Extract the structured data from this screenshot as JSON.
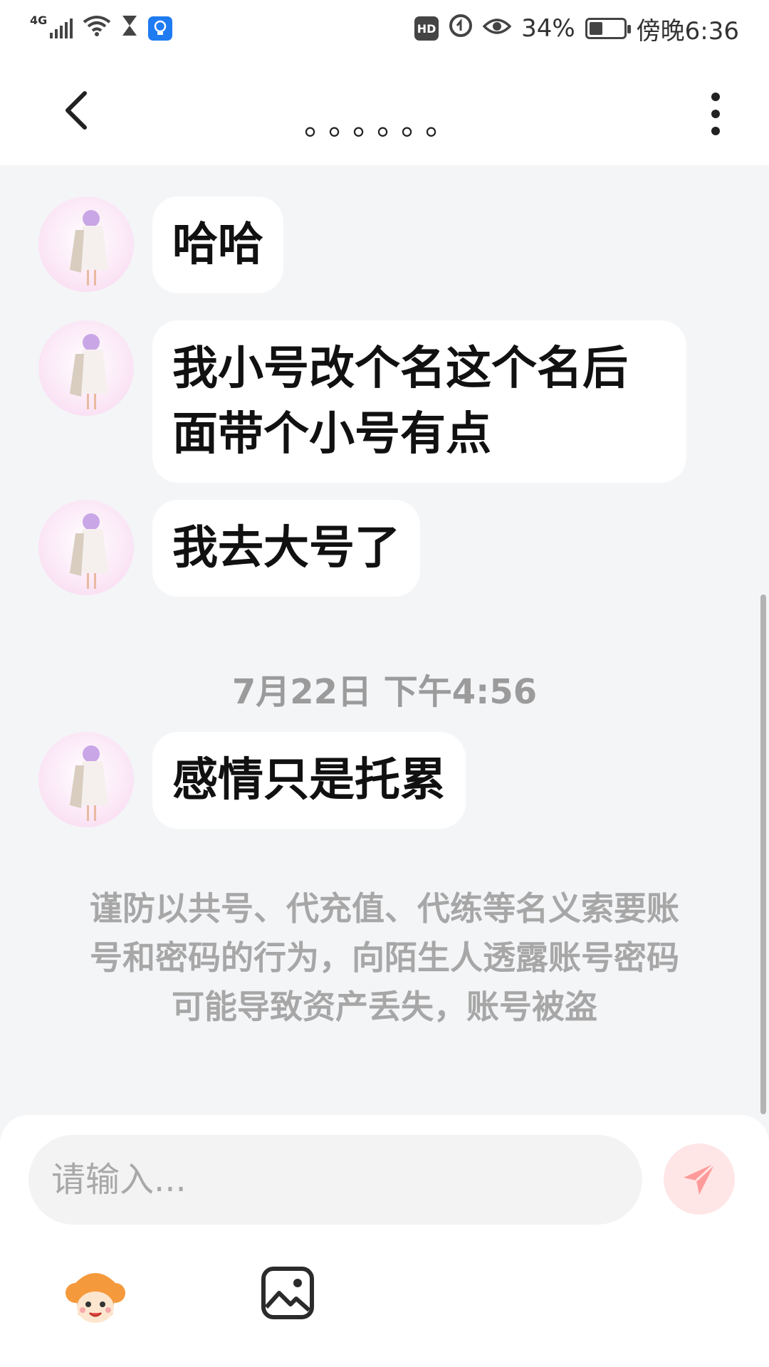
{
  "status_bar": {
    "network": "4G",
    "hd": "HD",
    "battery_percent": "34%",
    "time": "傍晚6:36",
    "icons": [
      "signal-icon",
      "wifi-icon",
      "hourglass-icon",
      "lightbulb-icon",
      "hd-icon",
      "data-saver-icon",
      "eye-icon",
      "battery-icon"
    ]
  },
  "header": {
    "title": "。。。。。。",
    "back_icon": "chevron-left-icon",
    "more_icon": "more-vertical-icon"
  },
  "messages": [
    {
      "text": "哈哈"
    },
    {
      "text": "我小号改个名这个名后面带个小号有点"
    },
    {
      "text": "我去大号了"
    },
    {
      "timestamp": "7月22日 下午4:56"
    },
    {
      "text": "感情只是托累"
    }
  ],
  "notice": "谨防以共号、代充值、代练等名义索要账号和密码的行为，向陌生人透露账号密码可能导致资产丢失，账号被盗",
  "composer": {
    "placeholder": "请输入...",
    "value": "",
    "send_icon": "send-icon",
    "emoji_icon": "emoji-sticker-icon",
    "image_icon": "image-icon",
    "accent_color": "#ff8a8a"
  }
}
